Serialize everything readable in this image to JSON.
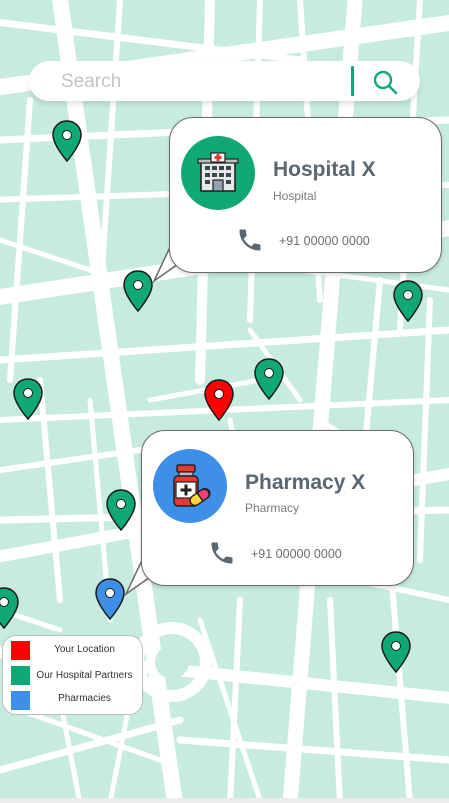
{
  "search": {
    "placeholder": "Search"
  },
  "colors": {
    "map_background": "#c8ebe1",
    "road": "#ffffff",
    "partner_green": "#11a877",
    "your_location_red": "#ff0000",
    "pharmacy_blue": "#3d8fe8"
  },
  "hospital_card": {
    "title": "Hospital X",
    "subtitle": "Hospital",
    "phone": "+91 00000 0000",
    "icon": "hospital-building-icon"
  },
  "pharmacy_card": {
    "title": "Pharmacy X",
    "subtitle": "Pharmacy",
    "phone": "+91 00000 0000",
    "icon": "medicine-bottle-icon"
  },
  "legend": {
    "items": [
      {
        "label": "Your Location",
        "color": "#ff0000"
      },
      {
        "label": "Our Hospital Partners",
        "color": "#11a877"
      },
      {
        "label": "Pharmacies",
        "color": "#3d8fe8"
      }
    ]
  }
}
